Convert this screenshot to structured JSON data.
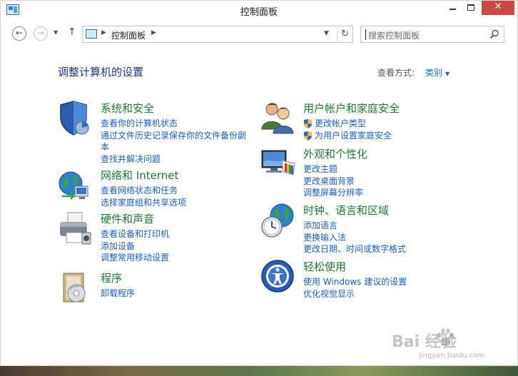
{
  "window": {
    "title": "控制面板",
    "controls": {
      "minimize": "",
      "maximize": "",
      "close": "✕"
    }
  },
  "nav": {
    "back_icon": "back-arrow-icon",
    "forward_icon": "forward-arrow-icon",
    "up_icon": "up-arrow-icon",
    "breadcrumb": "控制面板",
    "search_placeholder": "搜索控制面板"
  },
  "header": {
    "title": "调整计算机的设置",
    "view_label": "查看方式:",
    "view_value": "类别"
  },
  "categories": [
    {
      "title": "系统和安全",
      "icon": "shield-icon",
      "links": [
        "查看你的计算机状态",
        "通过文件历史记录保存你的文件备份副",
        "本",
        "查找并解决问题"
      ]
    },
    {
      "title": "网络和 Internet",
      "icon": "network-globe-icon",
      "links": [
        "查看网络状态和任务",
        "选择家庭组和共享选项"
      ]
    },
    {
      "title": "硬件和声音",
      "icon": "printer-icon",
      "links": [
        "查看设备和打印机",
        "添加设备",
        "调整常用移动设置"
      ]
    },
    {
      "title": "程序",
      "icon": "programs-icon",
      "links": [
        "卸载程序"
      ]
    },
    {
      "title": "用户帐户和家庭安全",
      "icon": "users-icon",
      "links": [
        "更改帐户类型",
        "为用户设置家庭安全"
      ]
    },
    {
      "title": "外观和个性化",
      "icon": "monitor-palette-icon",
      "links": [
        "更改主题",
        "更改桌面背景",
        "调整屏幕分辨率"
      ]
    },
    {
      "title": "时钟、语言和区域",
      "icon": "clock-globe-icon",
      "links": [
        "添加语言",
        "更换输入法",
        "更改日期、时间或数字格式"
      ]
    },
    {
      "title": "轻松使用",
      "icon": "ease-of-access-icon",
      "links": [
        "使用 Windows 建议的设置",
        "优化视觉显示"
      ]
    }
  ],
  "watermark": {
    "brand": "Bai 经验",
    "url": "jingyan.baidu.com"
  },
  "colors": {
    "title_blue": "#1e3287",
    "category_green": "#1f7a35",
    "link_blue": "#1e5ec2",
    "close_red": "#c74a43"
  }
}
